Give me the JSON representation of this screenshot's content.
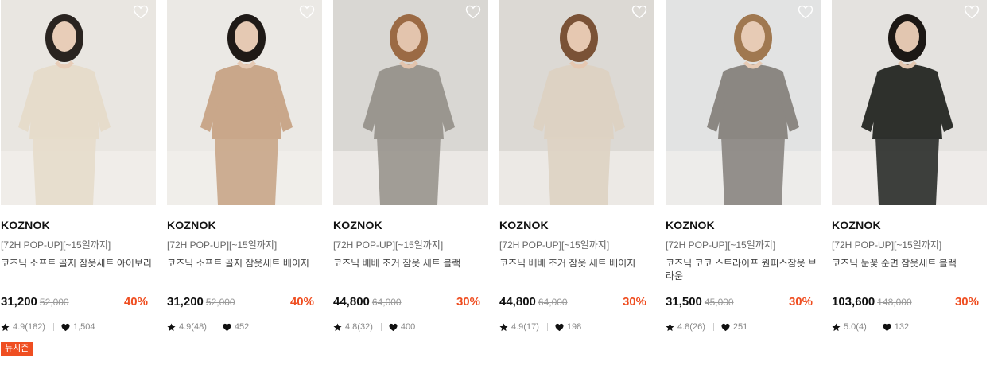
{
  "products": [
    {
      "brand": "KOZNOK",
      "promo": "[72H POP-UP][~15일까지]",
      "name": "코즈닉 소프트 골지 잠옷세트 아이보리",
      "price": "31,200",
      "original_price": "52,000",
      "discount": "40%",
      "rating": "4.9(182)",
      "likes": "1,504",
      "badge": "뉴시즌",
      "colors": {
        "bg": "#e9e6e1",
        "garment": "#e6dccb",
        "skin": "#e8cdb8",
        "hair": "#2a2420"
      }
    },
    {
      "brand": "KOZNOK",
      "promo": "[72H POP-UP][~15일까지]",
      "name": "코즈닉 소프트 골지 잠옷세트 베이지",
      "price": "31,200",
      "original_price": "52,000",
      "discount": "40%",
      "rating": "4.9(48)",
      "likes": "452",
      "colors": {
        "bg": "#ebe9e5",
        "garment": "#c9a78a",
        "skin": "#e5c9b3",
        "hair": "#1f1a17"
      }
    },
    {
      "brand": "KOZNOK",
      "promo": "[72H POP-UP][~15일까지]",
      "name": "코즈닉 베베 조거 잠옷 세트 블랙",
      "price": "44,800",
      "original_price": "64,000",
      "discount": "30%",
      "rating": "4.8(32)",
      "likes": "400",
      "colors": {
        "bg": "#d9d7d3",
        "garment": "#9a968f",
        "skin": "#e3c4ad",
        "hair": "#9b6a44"
      }
    },
    {
      "brand": "KOZNOK",
      "promo": "[72H POP-UP][~15일까지]",
      "name": "코즈닉 베베 조거 잠옷 세트 베이지",
      "price": "44,800",
      "original_price": "64,000",
      "discount": "30%",
      "rating": "4.9(17)",
      "likes": "198",
      "colors": {
        "bg": "#dcd9d4",
        "garment": "#ddd2c3",
        "skin": "#e6c8b1",
        "hair": "#7a5236"
      }
    },
    {
      "brand": "KOZNOK",
      "promo": "[72H POP-UP][~15일까지]",
      "name": "코즈닉 코코 스트라이프 원피스잠옷 브라운",
      "price": "31,500",
      "original_price": "45,000",
      "discount": "30%",
      "rating": "4.8(26)",
      "likes": "251",
      "colors": {
        "bg": "#e2e3e3",
        "garment": "#8b8782",
        "skin": "#e7cbb5",
        "hair": "#a07850"
      }
    },
    {
      "brand": "KOZNOK",
      "promo": "[72H POP-UP][~15일까지]",
      "name": "코즈닉 눈꽃 순면 잠옷세트 블랙",
      "price": "103,600",
      "original_price": "148,000",
      "discount": "30%",
      "rating": "5.0(4)",
      "likes": "132",
      "colors": {
        "bg": "#e4e2df",
        "garment": "#2e302c",
        "skin": "#e2c6b0",
        "hair": "#1c1815"
      }
    }
  ]
}
